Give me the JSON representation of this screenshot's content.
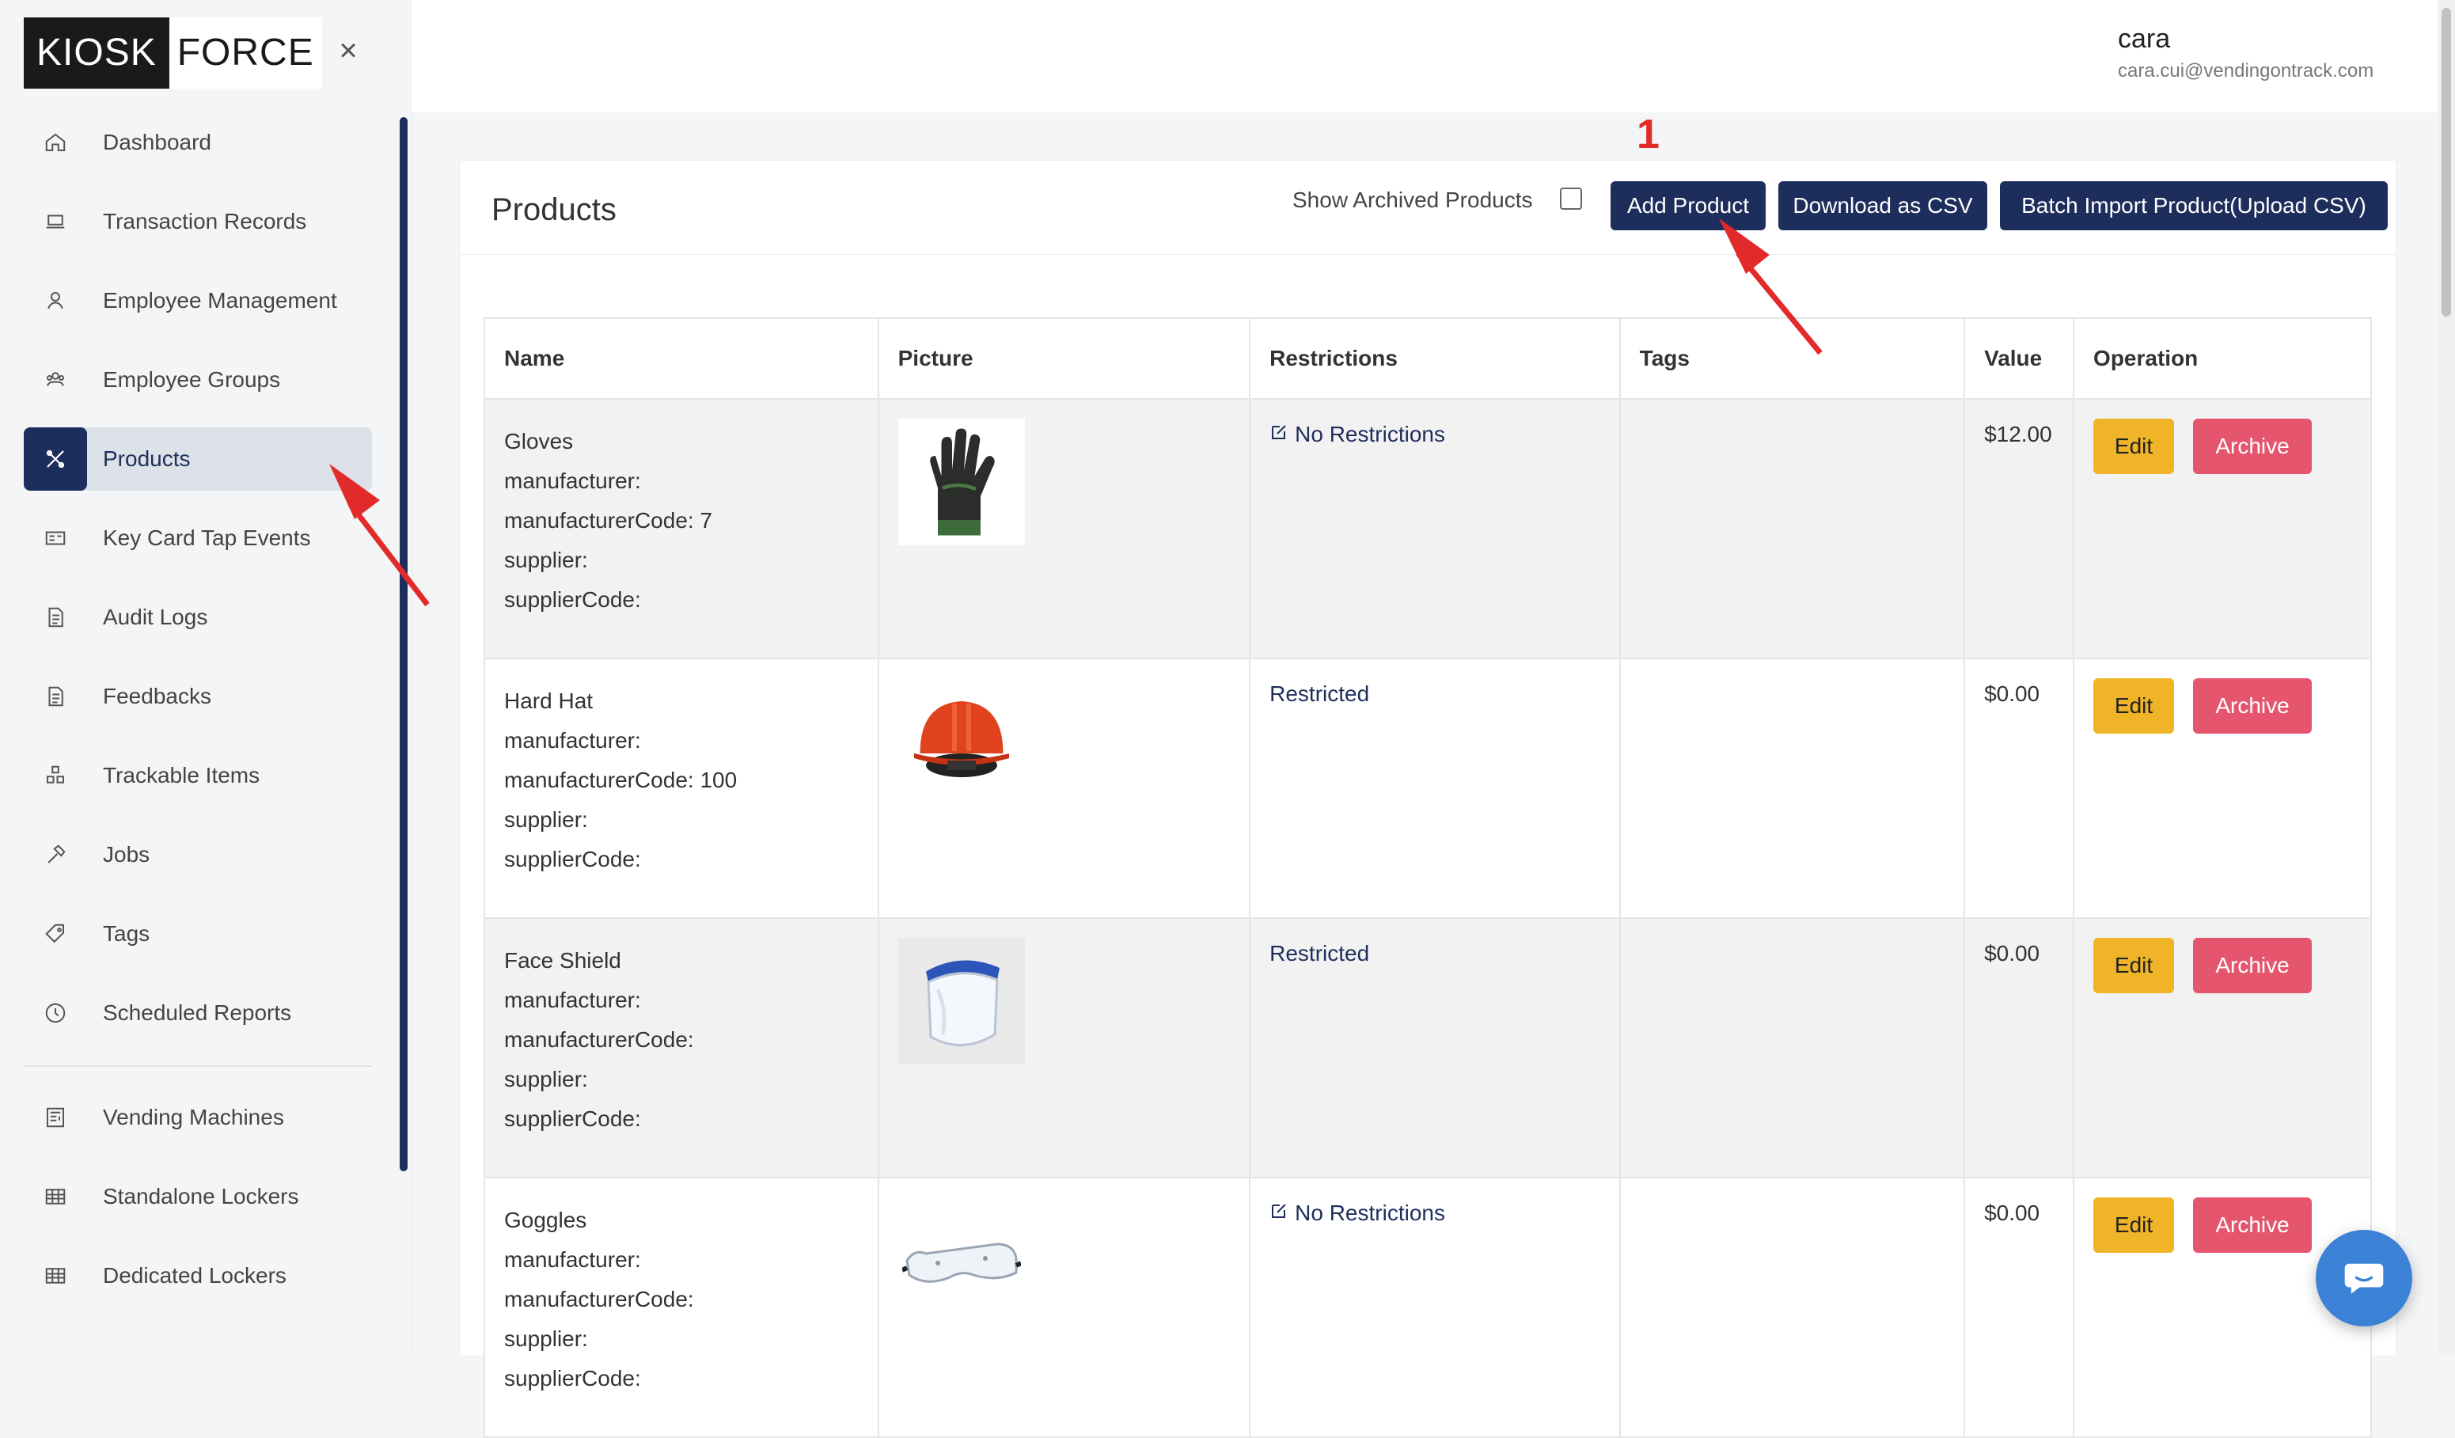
{
  "brand": {
    "logo_left": "KIOSK",
    "logo_right": "FORCE"
  },
  "sidebar": {
    "items": [
      {
        "label": "Dashboard",
        "icon": "home-icon"
      },
      {
        "label": "Transaction Records",
        "icon": "laptop-icon"
      },
      {
        "label": "Employee Management",
        "icon": "user-icon"
      },
      {
        "label": "Employee Groups",
        "icon": "group-icon"
      },
      {
        "label": "Products",
        "icon": "tools-icon",
        "active": true
      },
      {
        "label": "Key Card Tap Events",
        "icon": "id-card-icon"
      },
      {
        "label": "Audit Logs",
        "icon": "document-icon"
      },
      {
        "label": "Feedbacks",
        "icon": "document-icon"
      },
      {
        "label": "Trackable Items",
        "icon": "boxes-icon"
      },
      {
        "label": "Jobs",
        "icon": "hammer-icon"
      },
      {
        "label": "Tags",
        "icon": "tag-icon"
      },
      {
        "label": "Scheduled Reports",
        "icon": "clock-icon"
      }
    ],
    "items_secondary": [
      {
        "label": "Vending Machines",
        "icon": "vending-icon"
      },
      {
        "label": "Standalone Lockers",
        "icon": "grid-icon"
      },
      {
        "label": "Dedicated Lockers",
        "icon": "grid-icon"
      }
    ]
  },
  "user": {
    "name": "cara",
    "email": "cara.cui@vendingontrack.com"
  },
  "products_card": {
    "title": "Products",
    "show_archived_label": "Show Archived Products",
    "show_archived_checked": false,
    "add_label": "Add Product",
    "download_label": "Download as CSV",
    "batch_label": "Batch Import Product(Upload CSV)"
  },
  "annotation": {
    "step_number": "1"
  },
  "table": {
    "headers": [
      "Name",
      "Picture",
      "Restrictions",
      "Tags",
      "Value",
      "Operation"
    ],
    "rows": [
      {
        "name": "Gloves",
        "lines": [
          "manufacturer:",
          "manufacturerCode: 7",
          "supplier:",
          "supplierCode:"
        ],
        "picture": "gloves",
        "restriction": "No Restrictions",
        "restriction_icon": true,
        "tags": "",
        "value": "$12.00",
        "edit_label": "Edit",
        "archive_label": "Archive"
      },
      {
        "name": "Hard Hat",
        "lines": [
          "manufacturer:",
          "manufacturerCode: 100",
          "supplier:",
          "supplierCode:"
        ],
        "picture": "hard-hat",
        "restriction": "Restricted",
        "restriction_icon": false,
        "tags": "",
        "value": "$0.00",
        "edit_label": "Edit",
        "archive_label": "Archive"
      },
      {
        "name": "Face Shield",
        "lines": [
          "manufacturer:",
          "manufacturerCode:",
          "supplier:",
          "supplierCode:"
        ],
        "picture": "face-shield",
        "restriction": "Restricted",
        "restriction_icon": false,
        "tags": "",
        "value": "$0.00",
        "edit_label": "Edit",
        "archive_label": "Archive"
      },
      {
        "name": "Goggles",
        "lines": [
          "manufacturer:",
          "manufacturerCode:",
          "supplier:",
          "supplierCode:"
        ],
        "picture": "goggles",
        "restriction": "No Restrictions",
        "restriction_icon": true,
        "tags": "",
        "value": "$0.00",
        "edit_label": "Edit",
        "archive_label": "Archive"
      }
    ]
  },
  "colors": {
    "primary": "#1e2e5c",
    "edit": "#f0b429",
    "archive": "#e5566e",
    "annotation": "#e32a2a",
    "chat": "#3b82d6"
  }
}
